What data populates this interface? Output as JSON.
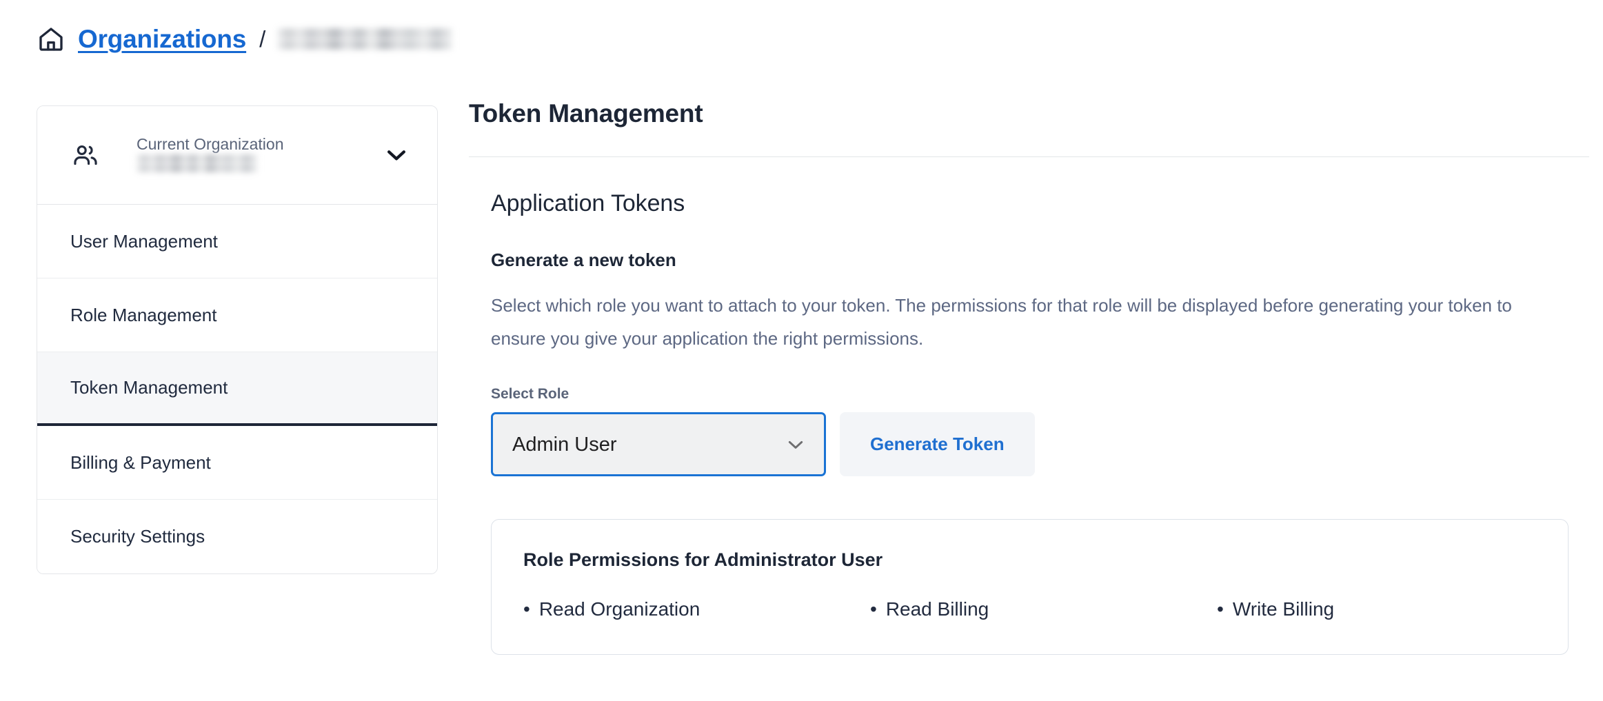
{
  "breadcrumb": {
    "home_icon": "home-icon",
    "link_label": "Organizations",
    "separator": "/",
    "current_label_redacted": true
  },
  "sidebar": {
    "org_switcher": {
      "icon": "users-icon",
      "label": "Current Organization",
      "org_name_redacted": true,
      "chevron": "chevron-down-icon"
    },
    "items": [
      {
        "label": "User Management",
        "active": false
      },
      {
        "label": "Role Management",
        "active": false
      },
      {
        "label": "Token Management",
        "active": true
      },
      {
        "label": "Billing & Payment",
        "active": false
      },
      {
        "label": "Security Settings",
        "active": false
      }
    ]
  },
  "main": {
    "page_title": "Token Management",
    "section_heading": "Application Tokens",
    "subsection_heading": "Generate a new token",
    "description": "Select which role you want to attach to your token. The permissions for that role will be displayed before generating your token to ensure you give your application the right permissions.",
    "select_role": {
      "label": "Select Role",
      "selected_value": "Admin User",
      "chevron": "chevron-down-icon"
    },
    "generate_button_label": "Generate Token",
    "permissions_card": {
      "title": "Role Permissions for Administrator User",
      "bullet": "•",
      "items": [
        "Read Organization",
        "Read Billing",
        "Write Billing"
      ]
    }
  },
  "colors": {
    "link_blue": "#1668d1",
    "accent_blue": "#1a73d4",
    "button_text_blue": "#1f6fd0",
    "text_dark": "#1d2636",
    "text_muted": "#5d6883",
    "active_indicator": "#1e2638",
    "active_bg": "#f6f7f9",
    "card_border": "#dde2e9"
  }
}
